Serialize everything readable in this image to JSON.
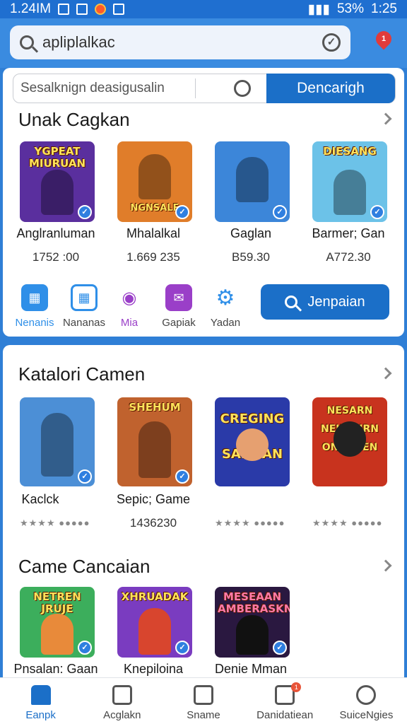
{
  "status": {
    "time_left": "1.24IM",
    "battery": "53%",
    "time_right": "1:25"
  },
  "header": {
    "query": "apliplalkac",
    "notif_count": "1"
  },
  "filter": {
    "placeholder": "Sesalknign deasigusalin",
    "button": "Dencarigh"
  },
  "section1": {
    "title": "Unak Cagkan",
    "games": [
      {
        "tile_text": "YGPEAT MIURUAN",
        "name": "Anglranluman",
        "value": "1752 :00",
        "bg": "#5a2f9e"
      },
      {
        "tile_text": "NGNSALF",
        "name": "Mhalalkal",
        "value": "1.669 235",
        "bg": "#e07d2a"
      },
      {
        "tile_text": "",
        "name": "Gaglan",
        "value": "B59.30",
        "bg": "#3c86d9"
      },
      {
        "tile_text": "DIESANG",
        "name": "Barmer; Gan",
        "value": "A772.30",
        "bg": "#6cc2e8"
      }
    ]
  },
  "quick": [
    {
      "label": "Nenanis",
      "color": "#2f8fe8",
      "icon": "calendar-icon"
    },
    {
      "label": "Nananas",
      "color": "#2f8fe8",
      "icon": "grid-icon"
    },
    {
      "label": "Mia",
      "color": "#9a3fc8",
      "icon": "user-icon"
    },
    {
      "label": "Gapiak",
      "color": "#9a3fc8",
      "icon": "mail-icon"
    },
    {
      "label": "Yadan",
      "color": "#2f8fe8",
      "icon": "gear-icon"
    }
  ],
  "search_button": "Jenpaian",
  "section2": {
    "title": "Katalori Camen",
    "games": [
      {
        "tile_text": "",
        "name": "Kaclck",
        "value": "",
        "stars": "★★★★ ●●●●●",
        "bg": "#4c8fd6"
      },
      {
        "tile_text": "SHEHUM",
        "name": "Sepic; Game",
        "value": "1436230",
        "stars": "",
        "bg": "#c0622e"
      },
      {
        "tile_text": "CREGING SAFMAN",
        "name": "",
        "value": "",
        "stars": "★★★★ ●●●●●",
        "bg": "#2a3aa8"
      },
      {
        "tile_text": "NESARN NEIENHRN ONAGUEN",
        "name": "",
        "value": "",
        "stars": "★★★★ ●●●●●",
        "bg": "#c8331e"
      }
    ]
  },
  "section3": {
    "title": "Came Cancaian",
    "games": [
      {
        "tile_text": "NETREN JRUJE",
        "name": "Pnsalan: Gaan",
        "bg": "#3cae5c"
      },
      {
        "tile_text": "XHRUADAK",
        "name": "Knepiloina",
        "bg": "#7a3cc0"
      },
      {
        "tile_text": "MESEAAN AMBERASKN",
        "name": "Denie Mman",
        "bg": "#2a1840"
      }
    ]
  },
  "nav": [
    {
      "label": "Eanpk",
      "active": true
    },
    {
      "label": "Acglakn",
      "active": false
    },
    {
      "label": "Sname",
      "active": false
    },
    {
      "label": "Danidatiean",
      "active": false,
      "badge": "1"
    },
    {
      "label": "SuiceNgies",
      "active": false
    }
  ]
}
